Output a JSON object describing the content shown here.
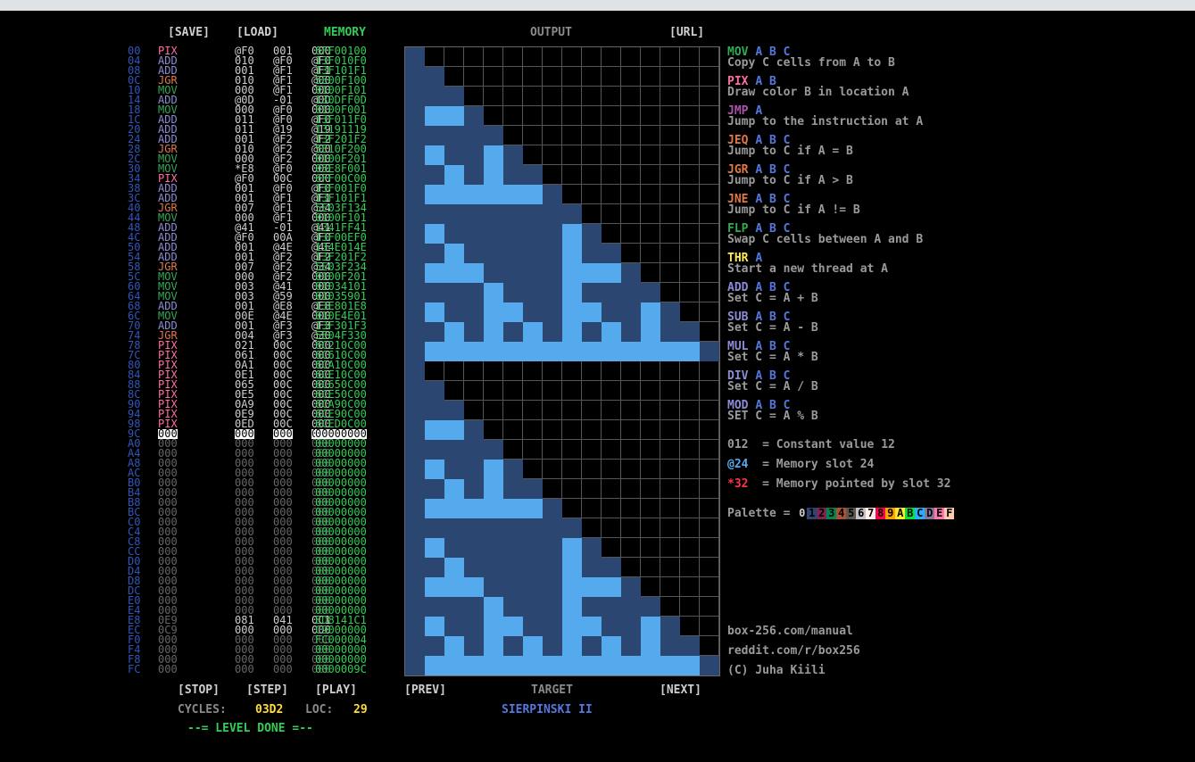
{
  "toolbar": {
    "save": "[SAVE]",
    "load": "[LOAD]",
    "memory": "MEMORY",
    "output": "OUTPUT",
    "url": "[URL]"
  },
  "code": [
    [
      "00",
      "PIX",
      "@F0",
      "001",
      "000",
      "6FF00100",
      "pix"
    ],
    [
      "04",
      "ADD",
      "010",
      "@F0",
      "@F0",
      "13F010F0",
      "add"
    ],
    [
      "08",
      "ADD",
      "001",
      "@F1",
      "@F1",
      "13F101F1",
      "add"
    ],
    [
      "0C",
      "JGR",
      "010",
      "@F1",
      "@00",
      "5E00F100",
      "jgr"
    ],
    [
      "10",
      "MOV",
      "000",
      "@F1",
      "000",
      "0100F101",
      "mov"
    ],
    [
      "14",
      "ADD",
      "@0D",
      "-01",
      "@0D",
      "130DFF0D",
      "add"
    ],
    [
      "18",
      "MOV",
      "000",
      "@F0",
      "000",
      "0100F001",
      "mov"
    ],
    [
      "1C",
      "ADD",
      "011",
      "@F0",
      "@F0",
      "13F011F0",
      "add"
    ],
    [
      "20",
      "ADD",
      "011",
      "@19",
      "@19",
      "13191119",
      "add"
    ],
    [
      "24",
      "ADD",
      "001",
      "@F2",
      "@F2",
      "13F201F2",
      "add"
    ],
    [
      "28",
      "JGR",
      "010",
      "@F2",
      "@00",
      "5E10F200",
      "jgr"
    ],
    [
      "2C",
      "MOV",
      "000",
      "@F2",
      "000",
      "0100F201",
      "mov"
    ],
    [
      "30",
      "MOV",
      "*E8",
      "@F0",
      "000",
      "05E8F001",
      "mov"
    ],
    [
      "34",
      "PIX",
      "@F0",
      "00C",
      "000",
      "6FF00C00",
      "pix"
    ],
    [
      "38",
      "ADD",
      "001",
      "@F0",
      "@F0",
      "13F001F0",
      "add"
    ],
    [
      "3C",
      "ADD",
      "001",
      "@F1",
      "@F1",
      "13F101F1",
      "add"
    ],
    [
      "40",
      "JGR",
      "007",
      "@F1",
      "@34",
      "5E03F134",
      "jgr"
    ],
    [
      "44",
      "MOV",
      "000",
      "@F1",
      "000",
      "0100F101",
      "mov"
    ],
    [
      "48",
      "ADD",
      "@41",
      "-01",
      "@41",
      "1341FF41",
      "add"
    ],
    [
      "4C",
      "ADD",
      "@F0",
      "00A",
      "@F0",
      "13F00EF0",
      "add"
    ],
    [
      "50",
      "ADD",
      "001",
      "@4E",
      "@4E",
      "134E014E",
      "add"
    ],
    [
      "54",
      "ADD",
      "001",
      "@F2",
      "@F2",
      "13F201F2",
      "add"
    ],
    [
      "58",
      "JGR",
      "007",
      "@F2",
      "@34",
      "5E03F234",
      "jgr"
    ],
    [
      "5C",
      "MOV",
      "000",
      "@F2",
      "000",
      "0100F201",
      "mov"
    ],
    [
      "60",
      "MOV",
      "003",
      "@41",
      "000",
      "01034101",
      "mov"
    ],
    [
      "64",
      "MOV",
      "003",
      "@59",
      "000",
      "01035901",
      "mov"
    ],
    [
      "68",
      "ADD",
      "001",
      "@E8",
      "@E8",
      "13E801E8",
      "add"
    ],
    [
      "6C",
      "MOV",
      "00E",
      "@4E",
      "000",
      "010E4E01",
      "mov"
    ],
    [
      "70",
      "ADD",
      "001",
      "@F3",
      "@F3",
      "13F301F3",
      "add"
    ],
    [
      "74",
      "JGR",
      "004",
      "@F3",
      "@30",
      "5E04F330",
      "jgr"
    ],
    [
      "78",
      "PIX",
      "021",
      "00C",
      "000",
      "6C210C00",
      "pix"
    ],
    [
      "7C",
      "PIX",
      "061",
      "00C",
      "000",
      "6C610C00",
      "pix"
    ],
    [
      "80",
      "PIX",
      "0A1",
      "00C",
      "000",
      "6CA10C00",
      "pix"
    ],
    [
      "84",
      "PIX",
      "0E1",
      "00C",
      "000",
      "6CE10C00",
      "pix"
    ],
    [
      "88",
      "PIX",
      "065",
      "00C",
      "000",
      "6C650C00",
      "pix"
    ],
    [
      "8C",
      "PIX",
      "0E5",
      "00C",
      "000",
      "6CE50C00",
      "pix"
    ],
    [
      "90",
      "PIX",
      "0A9",
      "00C",
      "000",
      "6CA90C00",
      "pix"
    ],
    [
      "94",
      "PIX",
      "0E9",
      "00C",
      "000",
      "6CE90C00",
      "pix"
    ],
    [
      "98",
      "PIX",
      "0ED",
      "00C",
      "000",
      "6CED0C00",
      "pix"
    ],
    [
      "9C",
      "000",
      "000",
      "000",
      "000",
      "00000000",
      "sel"
    ],
    [
      "A0",
      "000",
      "000",
      "000",
      "000",
      "00000000",
      "nil"
    ],
    [
      "A4",
      "000",
      "000",
      "000",
      "000",
      "00000000",
      "nil"
    ],
    [
      "A8",
      "000",
      "000",
      "000",
      "000",
      "00000000",
      "nil"
    ],
    [
      "AC",
      "000",
      "000",
      "000",
      "000",
      "00000000",
      "nil"
    ],
    [
      "B0",
      "000",
      "000",
      "000",
      "000",
      "00000000",
      "nil"
    ],
    [
      "B4",
      "000",
      "000",
      "000",
      "000",
      "00000000",
      "nil"
    ],
    [
      "B8",
      "000",
      "000",
      "000",
      "000",
      "00000000",
      "nil"
    ],
    [
      "BC",
      "000",
      "000",
      "000",
      "000",
      "00000000",
      "nil"
    ],
    [
      "C0",
      "000",
      "000",
      "000",
      "000",
      "00000000",
      "nil"
    ],
    [
      "C4",
      "000",
      "000",
      "000",
      "000",
      "00000000",
      "nil"
    ],
    [
      "C8",
      "000",
      "000",
      "000",
      "000",
      "00000000",
      "nil"
    ],
    [
      "CC",
      "000",
      "000",
      "000",
      "000",
      "00000000",
      "nil"
    ],
    [
      "D0",
      "000",
      "000",
      "000",
      "000",
      "00000000",
      "nil"
    ],
    [
      "D4",
      "000",
      "000",
      "000",
      "000",
      "00000000",
      "nil"
    ],
    [
      "D8",
      "000",
      "000",
      "000",
      "000",
      "00000000",
      "nil"
    ],
    [
      "DC",
      "000",
      "000",
      "000",
      "000",
      "00000000",
      "nil"
    ],
    [
      "E0",
      "000",
      "000",
      "000",
      "000",
      "00000000",
      "nil"
    ],
    [
      "E4",
      "000",
      "000",
      "000",
      "000",
      "00000000",
      "nil"
    ],
    [
      "E8",
      "0E9",
      "081",
      "041",
      "0C1",
      "ED8141C1",
      "dat"
    ],
    [
      "EC",
      "0C9",
      "000",
      "000",
      "000",
      "C9000000",
      "dat"
    ],
    [
      "F0",
      "000",
      "000",
      "000",
      "000",
      "FC000004",
      "nil"
    ],
    [
      "F4",
      "000",
      "000",
      "000",
      "000",
      "00000000",
      "nil"
    ],
    [
      "F8",
      "000",
      "000",
      "000",
      "000",
      "00000000",
      "nil"
    ],
    [
      "FC",
      "000",
      "000",
      "000",
      "000",
      "0000009C",
      "nil"
    ]
  ],
  "colors": {
    "dark": "#2b4670",
    "light": "#55aaee",
    "black": "#000000"
  },
  "help": [
    {
      "cmd": "MOV",
      "args": "A B C",
      "color": "#33aa55",
      "desc": "Copy C cells from A to B"
    },
    {
      "cmd": "PIX",
      "args": "A B",
      "color": "#ff6fa0",
      "desc": "Draw color B in location A"
    },
    {
      "cmd": "JMP",
      "args": "A",
      "color": "#aa55aa",
      "desc": "Jump to the instruction at A"
    },
    {
      "cmd": "JEQ",
      "args": "A B C",
      "color": "#e07848",
      "desc": "Jump to C if A = B"
    },
    {
      "cmd": "JGR",
      "args": "A B C",
      "color": "#e07848",
      "desc": "Jump to C if A > B"
    },
    {
      "cmd": "JNE",
      "args": "A B C",
      "color": "#e07848",
      "desc": "Jump to C if A != B"
    },
    {
      "cmd": "FLP",
      "args": "A B C",
      "color": "#33aa55",
      "desc": "Swap C cells between A and B"
    },
    {
      "cmd": "THR",
      "args": "A",
      "color": "#ffee55",
      "desc": "Start a new thread at A"
    },
    {
      "cmd": "ADD",
      "args": "A B C",
      "color": "#8c8cd6",
      "desc": "Set C = A + B"
    },
    {
      "cmd": "SUB",
      "args": "A B C",
      "color": "#8c8cd6",
      "desc": "Set C = A - B"
    },
    {
      "cmd": "MUL",
      "args": "A B C",
      "color": "#8c8cd6",
      "desc": "Set C = A * B"
    },
    {
      "cmd": "DIV",
      "args": "A B C",
      "color": "#8c8cd6",
      "desc": "Set C = A / B"
    },
    {
      "cmd": "MOD",
      "args": "A B C",
      "color": "#8c8cd6",
      "desc": "SET C = A % B"
    }
  ],
  "legend": {
    "const_key": "012",
    "const_text": "  = Constant value 12",
    "mem_key": "@24",
    "mem_text": "  = Memory slot 24",
    "ptr_key": "*32",
    "ptr_text": "  = Memory pointed by slot 32",
    "palette_label": "Palette = ",
    "palette_chars": [
      "0",
      "1",
      "2",
      "3",
      "4",
      "5",
      "6",
      "7",
      "8",
      "9",
      "A",
      "B",
      "C",
      "D",
      "E",
      "F"
    ],
    "palette_colors": [
      "#000000",
      "#2b4670",
      "#7e2553",
      "#008751",
      "#ab5236",
      "#5f574f",
      "#c2c3c7",
      "#fff1e8",
      "#ff004d",
      "#ffa300",
      "#ffec27",
      "#00e436",
      "#29adff",
      "#83769c",
      "#ff77a8",
      "#ffccaa"
    ]
  },
  "links": {
    "manual": "box-256.com/manual",
    "reddit": "reddit.com/r/box256",
    "credit": "(C) Juha Kiili"
  },
  "controls": {
    "stop": "[STOP]",
    "step": "[STEP]",
    "play": "[PLAY]",
    "prev": "[PREV]",
    "target": "TARGET",
    "next": "[NEXT]",
    "level_name": "SIERPINSKI II"
  },
  "status": {
    "cycles_label": "CYCLES:",
    "cycles": "03D2",
    "loc_label": "LOC:",
    "loc": "29",
    "done": "--= LEVEL DONE =--"
  }
}
